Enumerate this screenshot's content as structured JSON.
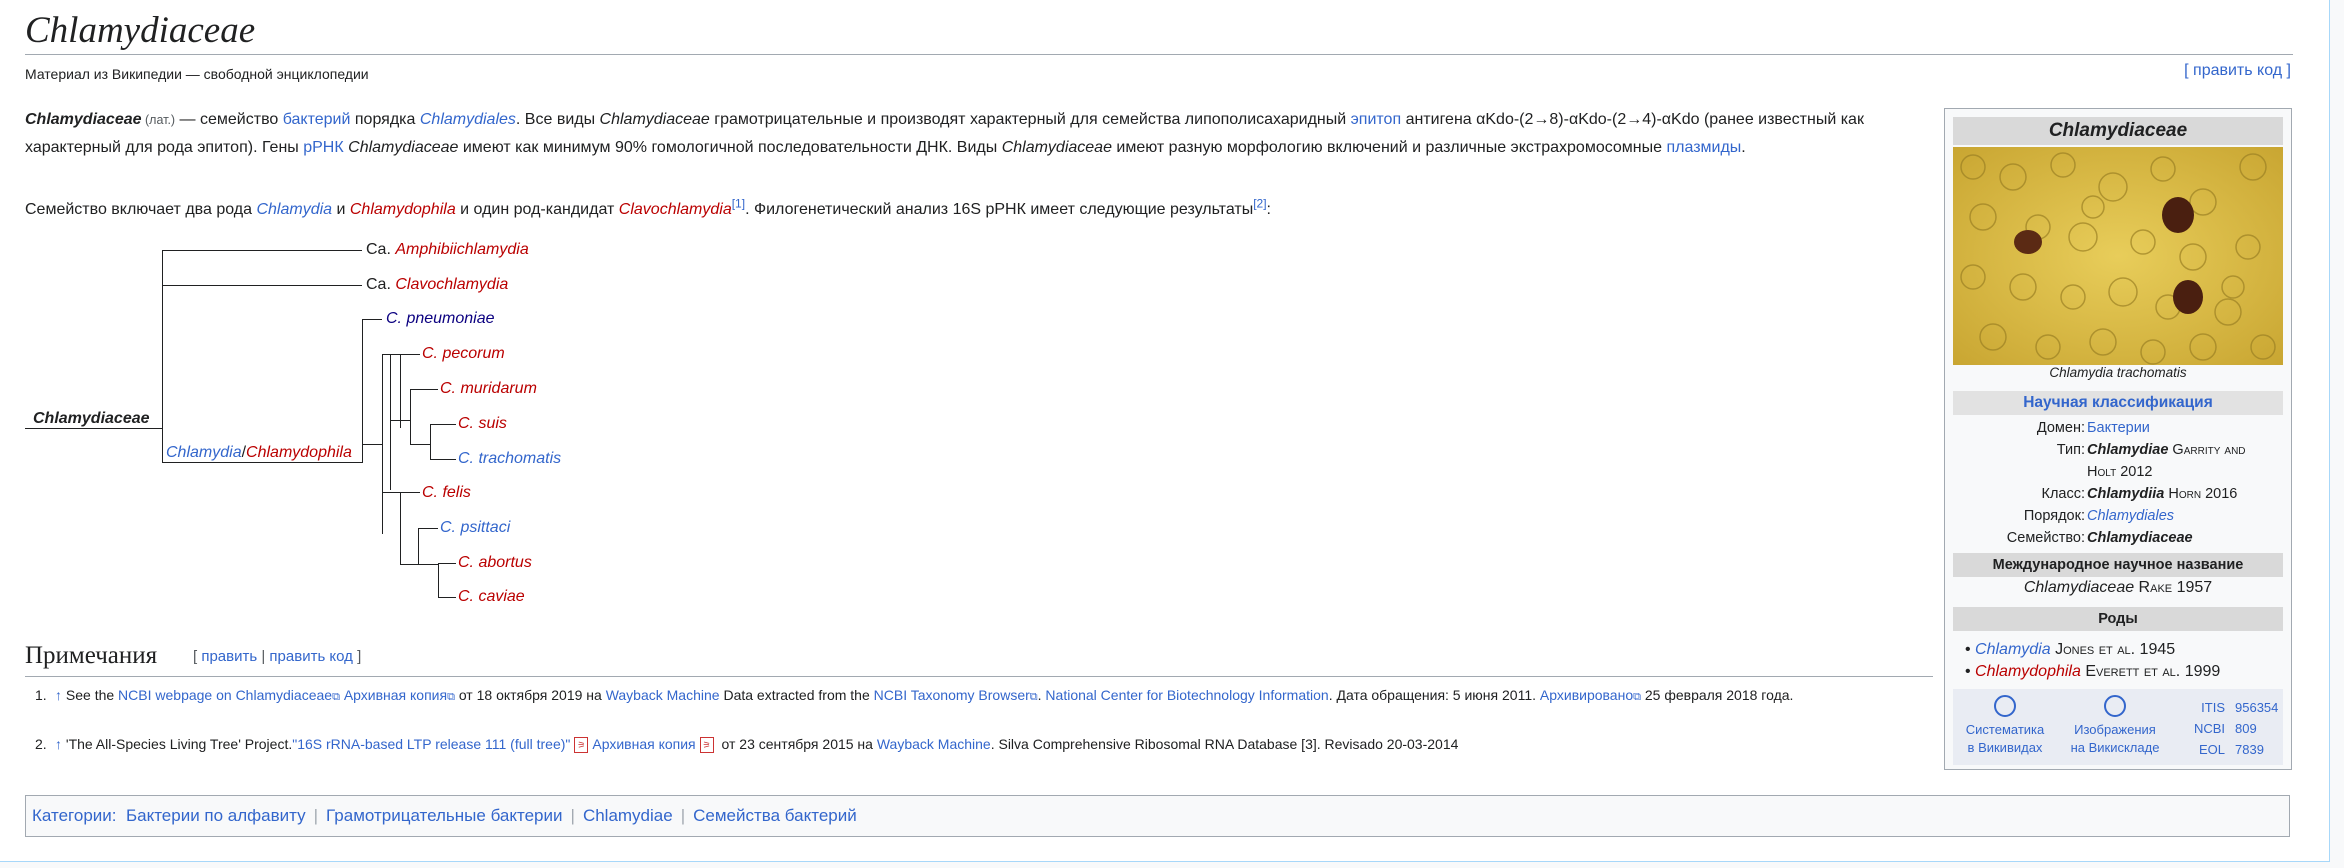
{
  "page": {
    "title": "Chlamydiaceae",
    "tagline": "Материал из Википедии — свободной энциклопедии",
    "edit_code": "[ править код ]"
  },
  "intro": {
    "p1": {
      "t1": "Chlamydiaceae",
      "t2": " (лат.)",
      "t3": " — семейство ",
      "t4": "бактерий",
      "t5": " порядка ",
      "t6": "Chlamydiales",
      "t7": ". Все виды ",
      "t8": "Chlamydiaceae",
      "t9": " грамотрицательные и производят характерный для семейства липополисахаридный ",
      "t10": "эпитоп",
      "t11": " антигена αKdo-(2→8)-αKdo-(2→4)-αKdo (ранее известный как характерный для рода эпитоп). Гены ",
      "t12": "рРНК",
      "t13": " ",
      "t14": "Chlamydiaceae",
      "t15": " имеют как минимум 90% гомологичной последовательности ДНК. Виды ",
      "t16": "Chlamydiaceae",
      "t17": " имеют разную морфологию включений и различные экстрахромосомные ",
      "t18": "плазмиды",
      "t19": "."
    },
    "p2": {
      "t1": "Семейство включает два рода ",
      "t2": "Chlamydia",
      "t3": " и ",
      "t4": "Chlamydophila",
      "t5": " и один род-кандидат ",
      "t6": "Clavochlamydia",
      "t7": "[1]",
      "t8": ". Филогенетический анализ 16S рРНК имеет следующие результаты",
      "t9": "[2]",
      "t10": ":"
    }
  },
  "cladogram": {
    "root": "Chlamydiaceae",
    "inner_label_a": "Chlamydia",
    "inner_label_sep": "/",
    "inner_label_b": "Chlamydophila",
    "leaves": [
      {
        "prefix": "Ca. ",
        "name": "Amphibiichlamydia"
      },
      {
        "prefix": "Ca. ",
        "name": "Clavochlamydia"
      },
      {
        "prefix": "",
        "name": "C. pneumoniae"
      },
      {
        "prefix": "",
        "name": "C. pecorum"
      },
      {
        "prefix": "",
        "name": "C. muridarum"
      },
      {
        "prefix": "",
        "name": "C. suis"
      },
      {
        "prefix": "",
        "name": "C. trachomatis"
      },
      {
        "prefix": "",
        "name": "C. felis"
      },
      {
        "prefix": "",
        "name": "C. psittaci"
      },
      {
        "prefix": "",
        "name": "C. abortus"
      },
      {
        "prefix": "",
        "name": "C. caviae"
      }
    ]
  },
  "notes": {
    "heading": "Примечания",
    "edit_open": "[ ",
    "edit": "править",
    "edit_sep": " | ",
    "edit_code": "править код",
    "edit_close": " ]",
    "ref1": {
      "num": "1.",
      "arrow": "↑",
      "a": " See the ",
      "b": "NCBI webpage on Chlamydiaceae",
      "c": "Архивная копия",
      "d": " от 18 октября 2019 на ",
      "e": "Wayback Machine",
      "f": " Data extracted from the ",
      "g": "NCBI Taxonomy Browser",
      "h": ". ",
      "i": "National Center for Biotechnology Information",
      "j": ". Дата обращения: 5 июня 2011. ",
      "k": "Архивировано",
      "l": " 25 февраля 2018 года."
    },
    "ref2": {
      "num": "2.",
      "arrow": "↑",
      "a": " 'The All-Species Living Tree' Project.",
      "b": "\"16S rRNA-based LTP release 111 (full tree)\"",
      "c": "Архивная копия",
      "d": " от 23 сентября 2015 на ",
      "e": "Wayback Machine",
      "f": ". Silva Comprehensive Ribosomal RNA Database [3]. Revisado 20-03-2014"
    }
  },
  "categories": {
    "label": "Категории:",
    "items": [
      "Бактерии по алфавиту",
      "Грамотрицательные бактерии",
      "Chlamydiae",
      "Семейства бактерий"
    ]
  },
  "infobox": {
    "title": "Chlamydiaceae",
    "caption": "Chlamydia trachomatis",
    "classification_heading": "Научная классификация",
    "rows": [
      {
        "key": "Домен:",
        "val": "Бактерии"
      },
      {
        "key": "Тип:",
        "val": "Chlamydiae",
        "auth": " Garrity and Holt 2012"
      },
      {
        "key": "Класс:",
        "val": "Chlamydiia",
        "auth": " Horn 2016"
      },
      {
        "key": "Порядок:",
        "val": "Chlamydiales"
      },
      {
        "key": "Семейство:",
        "val": "Chlamydiaceae"
      }
    ],
    "intl_heading": "Международное научное название",
    "intl_name": "Chlamydiaceae",
    "intl_auth": " Rake 1957",
    "genera_heading": "Роды",
    "genera": [
      {
        "name": "Chlamydia",
        "auth": " Jones et al.",
        "year": " 1945"
      },
      {
        "name": "Chlamydophila",
        "auth": " Everett et al.",
        "year": " 1999"
      }
    ],
    "links": {
      "wikispecies_1": "Систематика",
      "wikispecies_2": "в Викивидах",
      "commons_1": "Изображения",
      "commons_2": "на Викискладе"
    },
    "ids": [
      {
        "k": "ITIS",
        "v": "956354"
      },
      {
        "k": "NCBI",
        "v": "809"
      },
      {
        "k": "EOL",
        "v": "7839"
      }
    ]
  }
}
